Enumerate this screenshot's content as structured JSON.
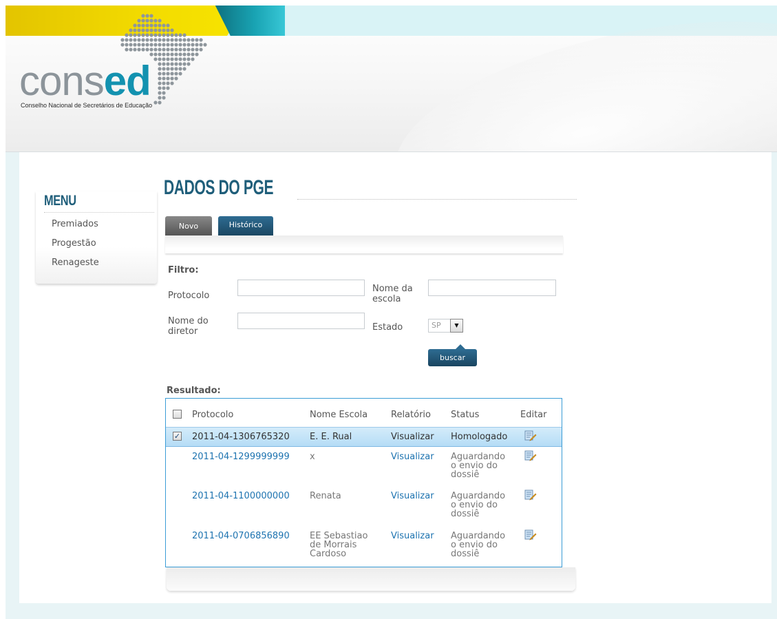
{
  "logo": {
    "text_cons": "cons",
    "text_ed": "ed",
    "subtitle": "Conselho Nacional de Secretários de Educação"
  },
  "menu": {
    "title": "MENU",
    "items": [
      {
        "label": "Premiados"
      },
      {
        "label": "Progestão"
      },
      {
        "label": "Renageste"
      }
    ]
  },
  "page": {
    "title": "DADOS DO PGE"
  },
  "tabs": [
    {
      "label": "Novo",
      "active": false
    },
    {
      "label": "Histórico",
      "active": true
    }
  ],
  "filter": {
    "heading": "Filtro:",
    "protocolo_label": "Protocolo",
    "protocolo_value": "",
    "nome_escola_label": "Nome da escola",
    "nome_escola_value": "",
    "nome_diretor_label": "Nome do diretor",
    "nome_diretor_value": "",
    "estado_label": "Estado",
    "estado_value": "SP",
    "buscar_label": "buscar"
  },
  "results": {
    "heading": "Resultado:",
    "columns": [
      "Protocolo",
      "Nome Escola",
      "Relatório",
      "Status",
      "Editar"
    ],
    "rows": [
      {
        "protocolo": "2011-04-1306765320",
        "escola": "E. E. Rual",
        "relatorio": "Visualizar",
        "status": "Homologado",
        "checked": true
      },
      {
        "protocolo": "2011-04-1299999999",
        "escola": "x",
        "relatorio": "Visualizar",
        "status": "Aguardando o envio do dossiê",
        "checked": false
      },
      {
        "protocolo": "2011-04-1100000000",
        "escola": "Renata",
        "relatorio": "Visualizar",
        "status": "Aguardando o envio do dossiê",
        "checked": false
      },
      {
        "protocolo": "2011-04-0706856890",
        "escola": "EE Sebastiao de Morrais Cardoso",
        "relatorio": "Visualizar",
        "status": "Aguardando o envio do dossiê",
        "checked": false
      }
    ]
  },
  "colors": {
    "brand_blue": "#1f5e7a",
    "link_blue": "#1d73b0",
    "highlight": "#c4e4f9",
    "yellow": "#f3dc00",
    "teal": "#19a3b3"
  }
}
